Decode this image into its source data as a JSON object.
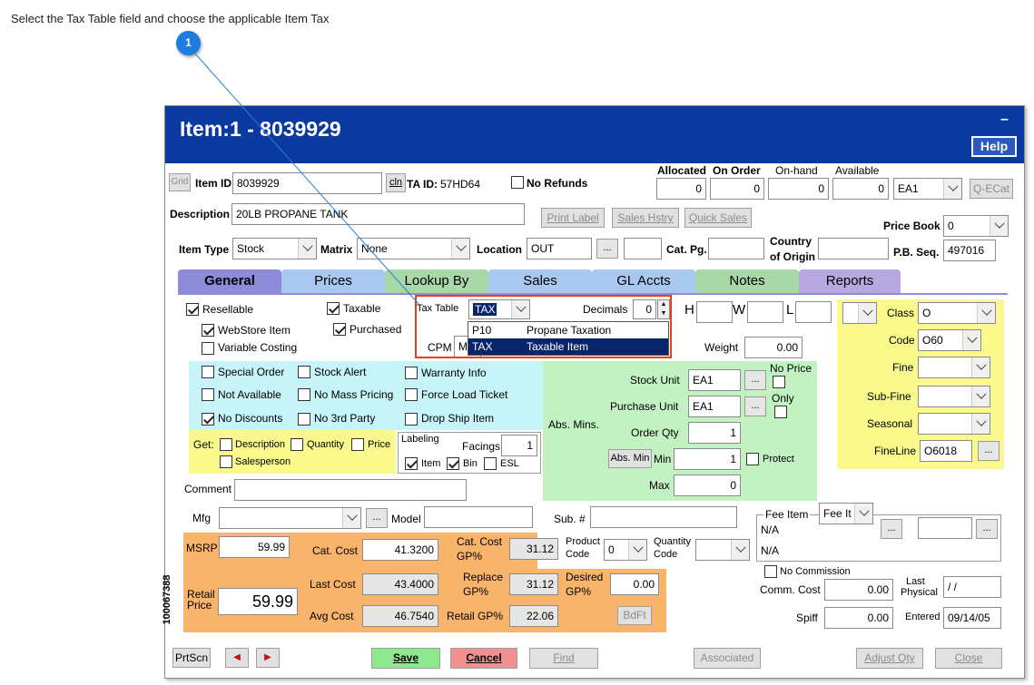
{
  "instruction": "Select the Tax Table field and choose the applicable Item Tax",
  "callout_number": "1",
  "window": {
    "title": "Item:1 - 8039929",
    "minimize_glyph": "–",
    "help_label": "Help",
    "side_code": "100067388"
  },
  "header_row": {
    "grid_btn": "Grid",
    "item_id_label": "Item ID",
    "item_id_value": "8039929",
    "cln_btn": "cln",
    "ta_id_label": "TA ID:",
    "ta_id_value": "57HD64",
    "no_refunds_label": "No Refunds",
    "allocated_label": "Allocated",
    "allocated_value": "0",
    "on_order_label": "On Order",
    "on_order_value": "0",
    "on_hand_label": "On-hand",
    "on_hand_value": "0",
    "available_label": "Available",
    "available_value": "0",
    "uom_value": "EA1",
    "qecat_btn": "Q-ECat"
  },
  "description_row": {
    "label": "Description",
    "value": "20LB PROPANE TANK",
    "print_label_btn": "Print Label",
    "sales_hstry_btn": "Sales Hstry",
    "quick_sales_btn": "Quick Sales",
    "price_book_label": "Price Book",
    "price_book_value": "0"
  },
  "type_row": {
    "item_type_label": "Item Type",
    "item_type_value": "Stock",
    "matrix_label": "Matrix",
    "matrix_value": "None",
    "location_label": "Location",
    "location_value": "OUT",
    "cat_pg_label": "Cat. Pg.",
    "country_label_1": "Country",
    "country_label_2": "of Origin",
    "pb_seq_label": "P.B. Seq.",
    "pb_seq_value": "497016",
    "dots": "..."
  },
  "tabs": [
    {
      "label": "General",
      "color": "#8c8cd8"
    },
    {
      "label": "Prices",
      "color": "#a8c8f0"
    },
    {
      "label": "Lookup By",
      "color": "#a8d8a8"
    },
    {
      "label": "Sales",
      "color": "#a8c8f0"
    },
    {
      "label": "GL Accts",
      "color": "#a8c8f0"
    },
    {
      "label": "Notes",
      "color": "#a8d8a8"
    },
    {
      "label": "Reports",
      "color": "#b8a8e0"
    }
  ],
  "general": {
    "resellable": "Resellable",
    "taxable": "Taxable",
    "webstore_item": "WebStore Item",
    "purchased": "Purchased",
    "variable_costing": "Variable Costing",
    "tax_table_label": "Tax Table",
    "tax_table_value": "TAX",
    "tax_options": [
      {
        "code": "P10",
        "name": "Propane Taxation"
      },
      {
        "code": "TAX",
        "name": "Taxable Item"
      }
    ],
    "decimals_label": "Decimals",
    "decimals_value": "0",
    "h_label": "H",
    "w_label": "W",
    "l_label": "L",
    "cpm_label": "CPM",
    "cpm_value": "M",
    "weight_label": "Weight",
    "weight_value": "0.00",
    "special_order": "Special Order",
    "stock_alert": "Stock Alert",
    "warranty_info": "Warranty Info",
    "not_available": "Not Available",
    "no_mass_pricing": "No Mass Pricing",
    "force_load_ticket": "Force Load Ticket",
    "no_discounts": "No Discounts",
    "no_3rd_party": "No 3rd Party",
    "drop_ship_item": "Drop Ship Item",
    "get_label": "Get:",
    "get_description": "Description",
    "get_quantity": "Quantity",
    "get_price": "Price",
    "get_salesperson": "Salesperson",
    "labeling_label": "Labeling",
    "facings_label": "Facings",
    "facings_value": "1",
    "label_item": "Item",
    "label_bin": "Bin",
    "label_esl": "ESL",
    "stock_unit_label": "Stock Unit",
    "stock_unit_value": "EA1",
    "purchase_unit_label": "Purchase Unit",
    "purchase_unit_value": "EA1",
    "no_price_label": "No Price",
    "only_label": "Only",
    "abs_mins_label": "Abs. Mins.",
    "order_qty_label": "Order Qty",
    "order_qty_value": "1",
    "abs_min_btn": "Abs. Min",
    "min_label": "Min",
    "min_value": "1",
    "protect_label": "Protect",
    "max_label": "Max",
    "max_value": "0",
    "class_label": "Class",
    "class_value": "O",
    "code_label": "Code",
    "code_value": "O60",
    "fine_label": "Fine",
    "sub_fine_label": "Sub-Fine",
    "seasonal_label": "Seasonal",
    "fineline_label": "FineLine",
    "fineline_value": "O6018",
    "comment_label": "Comment",
    "mfg_label": "Mfg",
    "model_label": "Model",
    "sub_label": "Sub. #",
    "fee_item_label": "Fee Item",
    "fee_item_select": "Fee It",
    "fee_na_1": "N/A",
    "fee_na_2": "N/A"
  },
  "pricing": {
    "msrp_label": "MSRP",
    "msrp_value": "59.99",
    "cat_cost_label": "Cat. Cost",
    "cat_cost_value": "41.3200",
    "cat_cost_gp_label_1": "Cat. Cost",
    "cat_cost_gp_label_2": "GP%",
    "cat_cost_gp_value": "31.12",
    "product_code_label_1": "Product",
    "product_code_label_2": "Code",
    "product_code_value": "0",
    "quantity_code_label_1": "Quantity",
    "quantity_code_label_2": "Code",
    "retail_price_label_1": "Retail",
    "retail_price_label_2": "Price",
    "retail_price_value": "59.99",
    "last_cost_label": "Last Cost",
    "last_cost_value": "43.4000",
    "replace_gp_label_1": "Replace",
    "replace_gp_label_2": "GP%",
    "replace_gp_value": "31.12",
    "desired_gp_label_1": "Desired",
    "desired_gp_label_2": "GP%",
    "desired_gp_value": "0.00",
    "avg_cost_label": "Avg Cost",
    "avg_cost_value": "46.7540",
    "retail_gp_label": "Retail GP%",
    "retail_gp_value": "22.06",
    "bdft_btn": "BdFt",
    "no_commission_label": "No Commission",
    "comm_cost_label": "Comm. Cost",
    "comm_cost_value": "0.00",
    "last_physical_label_1": "Last",
    "last_physical_label_2": "Physical",
    "last_physical_value": "/ /",
    "spiff_label": "Spiff",
    "spiff_value": "0.00",
    "entered_label": "Entered",
    "entered_value": "09/14/05"
  },
  "footer": {
    "prtscn": "PrtScn",
    "save": "Save",
    "cancel": "Cancel",
    "find": "Find",
    "associated": "Associated",
    "adjust_qty": "Adjust Qty",
    "close": "Close"
  }
}
